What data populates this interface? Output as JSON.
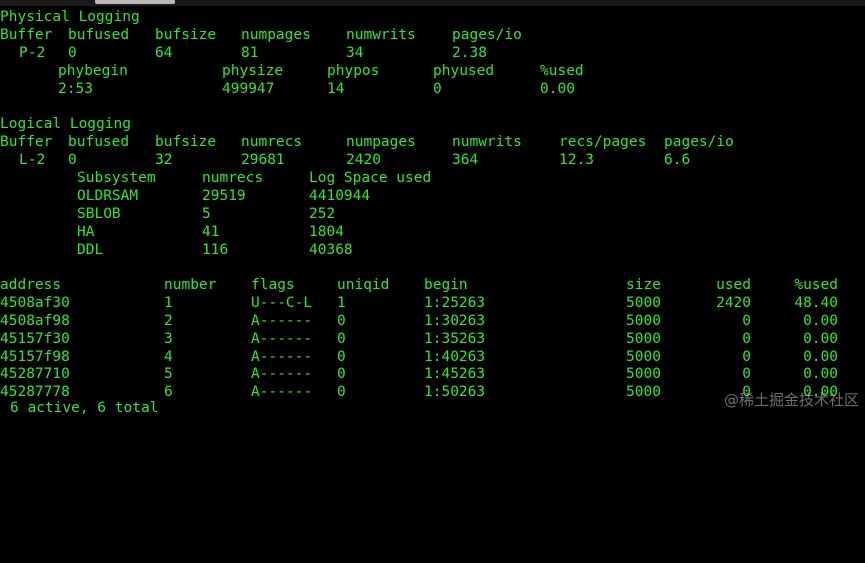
{
  "physical": {
    "title": "Physical Logging",
    "headers": [
      "Buffer",
      "bufused",
      "bufsize",
      "numpages",
      "numwrits",
      "pages/io"
    ],
    "row": [
      "P-2",
      "0",
      "64",
      "81",
      "34",
      "2.38"
    ],
    "sub_headers": [
      "phybegin",
      "physize",
      "phypos",
      "phyused",
      "%used"
    ],
    "sub_row": [
      "2:53",
      "499947",
      "14",
      "0",
      "0.00"
    ]
  },
  "logical": {
    "title": "Logical Logging",
    "headers": [
      "Buffer",
      "bufused",
      "bufsize",
      "numrecs",
      "numpages",
      "numwrits",
      "recs/pages",
      "pages/io"
    ],
    "row": [
      "L-2",
      "0",
      "32",
      "29681",
      "2420",
      "364",
      "12.3",
      "6.6"
    ],
    "subsystem_headers": [
      "Subsystem",
      "numrecs",
      "Log Space used"
    ],
    "subsystems": [
      [
        "OLDRSAM",
        "29519",
        "4410944"
      ],
      [
        "SBLOB",
        "5",
        "252"
      ],
      [
        "HA",
        "41",
        "1804"
      ],
      [
        "DDL",
        "116",
        "40368"
      ]
    ]
  },
  "logfiles": {
    "headers": [
      "address",
      "number",
      "flags",
      "uniqid",
      "begin",
      "size",
      "used",
      "%used"
    ],
    "rows": [
      [
        "4508af30",
        "1",
        "U---C-L",
        "1",
        "1:25263",
        "5000",
        "2420",
        "48.40"
      ],
      [
        "4508af98",
        "2",
        "A------",
        "0",
        "1:30263",
        "5000",
        "0",
        "0.00"
      ],
      [
        "45157f30",
        "3",
        "A------",
        "0",
        "1:35263",
        "5000",
        "0",
        "0.00"
      ],
      [
        "45157f98",
        "4",
        "A------",
        "0",
        "1:40263",
        "5000",
        "0",
        "0.00"
      ],
      [
        "45287710",
        "5",
        "A------",
        "0",
        "1:45263",
        "5000",
        "0",
        "0.00"
      ],
      [
        "45287778",
        "6",
        "A------",
        "0",
        "1:50263",
        "5000",
        "0",
        "0.00"
      ]
    ],
    "summary": "6 active, 6 total"
  },
  "watermark": "@稀土掘金技术社区",
  "colors": {
    "text": "#2ee82e",
    "background": "#000000"
  }
}
